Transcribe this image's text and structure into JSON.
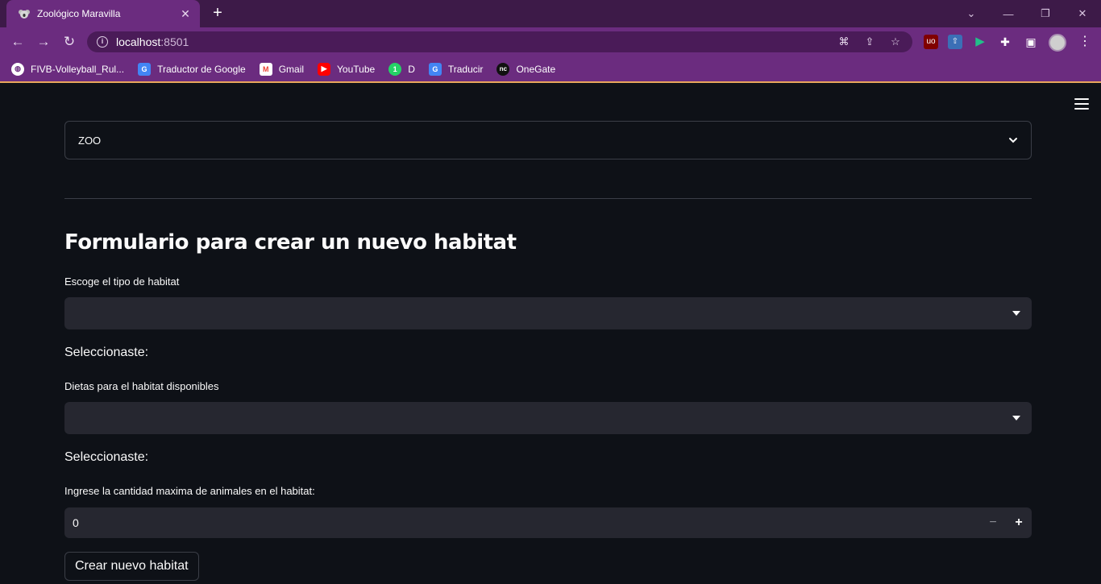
{
  "browser": {
    "tab_title": "Zoológico Maravilla",
    "url_host": "localhost",
    "url_port": ":8501",
    "bookmarks": [
      {
        "label": "FIVB-Volleyball_Rul...",
        "icon": "globe-icon",
        "color": "#ffffff"
      },
      {
        "label": "Traductor de Google",
        "icon": "google-translate-icon",
        "color": "#4285f4"
      },
      {
        "label": "Gmail",
        "icon": "gmail-icon",
        "color": "#ea4335"
      },
      {
        "label": "YouTube",
        "icon": "youtube-icon",
        "color": "#ff0000"
      },
      {
        "label": "D",
        "icon": "whatsapp-icon",
        "color": "#25d366"
      },
      {
        "label": "Traducir",
        "icon": "google-translate-icon",
        "color": "#4285f4"
      },
      {
        "label": "OneGate",
        "icon": "onegate-icon",
        "color": "#111111"
      }
    ],
    "colors": {
      "frame": "#3d1a48",
      "toolbar": "#6b2c7f",
      "omnibox": "#4a1b58"
    }
  },
  "app": {
    "zoo_select_value": "ZOO",
    "form_title": "Formulario para crear un nuevo habitat",
    "habitat_type_label": "Escoge el tipo de habitat",
    "habitat_type_value": "",
    "selected_1": "Seleccionaste:",
    "diet_label": "Dietas para el habitat disponibles",
    "diet_value": "",
    "selected_2": "Seleccionaste:",
    "max_animals_label": "Ingrese la cantidad maxima de animales en el habitat:",
    "max_animals_value": "0",
    "create_button": "Crear nuevo habitat",
    "colors": {
      "background": "#0e1117",
      "input_bg": "#262730",
      "border": "#3b3e47",
      "text": "#fafafa"
    }
  }
}
